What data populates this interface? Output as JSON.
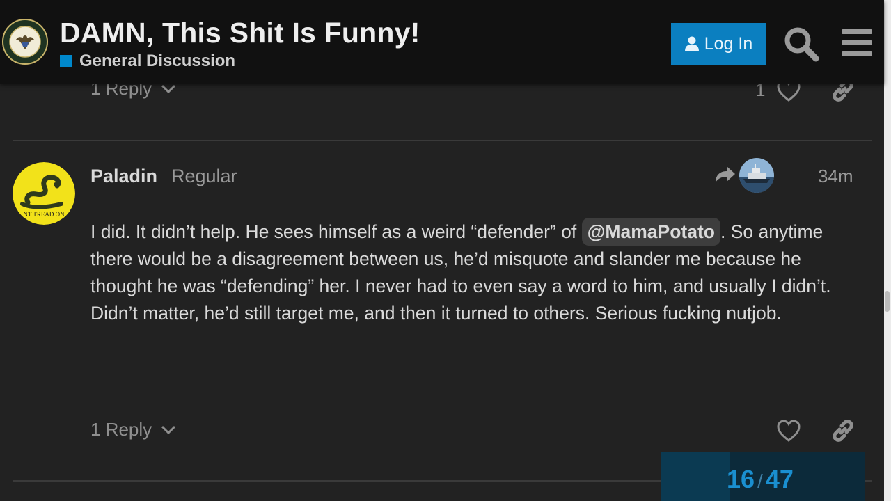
{
  "header": {
    "title": "DAMN, This Shit Is Funny!",
    "category": "General Discussion",
    "login_label": "Log In",
    "logo_icon": "army-seal-logo-icon",
    "category_color": "#0088cc",
    "accent": "#0b7fc0"
  },
  "previous_post": {
    "reply_label": "1 Reply",
    "like_count": "1"
  },
  "post": {
    "username": "Paladin",
    "user_title": "Regular",
    "time": "34m",
    "body_before": "I did. It didn’t help. He sees himself as a weird “defender” of ",
    "mention": "@MamaPotato",
    "body_after": ". So anytime there would be a disagreement between us, he’d misquote and slander me because he thought he was “defending” her. I never had to even say a word to him, and usually I didn’t. Didn’t matter, he’d still target me, and then it turned to others. Serious fucking nutjob.",
    "reply_label": "1 Reply"
  },
  "timeline": {
    "current": "16",
    "separator": "/",
    "total": "47",
    "progress_fraction": 0.34
  }
}
